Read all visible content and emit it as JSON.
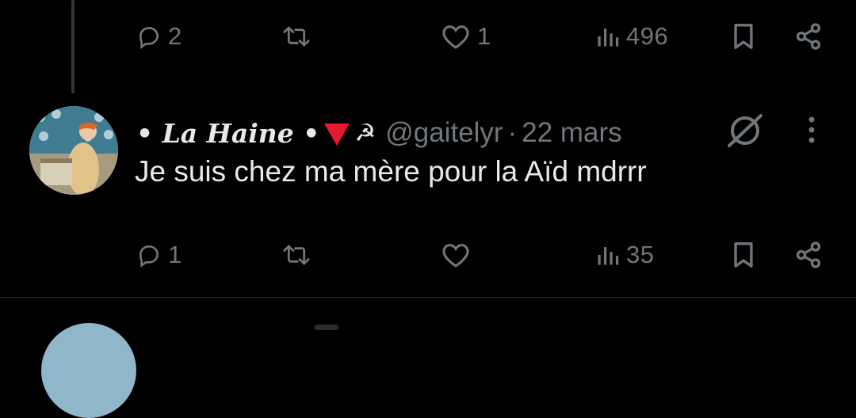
{
  "colors": {
    "background": "#000000",
    "text": "#e7e9ea",
    "muted": "#71767b",
    "accent_emoji": "#e8192c"
  },
  "prev_tweet": {
    "actions": {
      "reply_count": "2",
      "retweet_count": "",
      "like_count": "1",
      "views_count": "496"
    }
  },
  "tweet": {
    "display_name": "• La Haine •",
    "emojis": [
      "down-red-triangle",
      "hammer-sickle"
    ],
    "hammer_sickle_glyph": "☭",
    "handle": "@gaitelyr",
    "separator": "·",
    "time": "22 mars",
    "text": "Je suis chez ma mère pour la Aïd mdrrr",
    "actions": {
      "reply_count": "1",
      "retweet_count": "",
      "like_count": "",
      "views_count": "35"
    }
  },
  "icons": [
    "reply-icon",
    "retweet-icon",
    "like-icon",
    "views-icon",
    "bookmark-icon",
    "share-icon",
    "grok-icon",
    "more-icon"
  ]
}
